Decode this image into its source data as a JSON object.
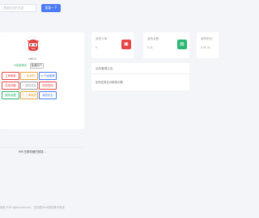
{
  "search": {
    "placeholder": "入需要查询的关键",
    "button_label": "我要一下"
  },
  "profile": {
    "avatar_icon": "smiling-face-icon",
    "username": "UID:2",
    "vip_label": "※仙发网中",
    "level_badge": "普通用户",
    "grid": [
      {
        "label": "立即刷新",
        "color": "#e64545"
      },
      {
        "label": "☆ 免费购",
        "color": "#e6a23c"
      },
      {
        "label": "★ 升级套餐",
        "color": "#4a7bf4"
      },
      {
        "label": "在线问题",
        "color": "#e64545"
      },
      {
        "label": "☆ 我的钱包",
        "color": "#999999"
      },
      {
        "label": "修改密码",
        "color": "#e64545"
      },
      {
        "label": "服务收藏",
        "color": "#2bb673"
      },
      {
        "label": "☆ 工单管理",
        "color": "#e6a23c"
      },
      {
        "label": "我的实名",
        "color": "#4a7bf4"
      }
    ],
    "footer_link": "Will 还原收藏的链接→"
  },
  "stats": [
    {
      "label": "我的订单",
      "value": "0",
      "icon": "cart-icon",
      "color": "#e64545"
    },
    {
      "label": "我的余额",
      "value": "0 元",
      "icon": "wallet-icon",
      "color": "#2bb673"
    },
    {
      "label": "我的积分",
      "value": "0.00 元",
      "icon": "",
      "color": ""
    }
  ],
  "notice": {
    "title": "站内管理公告",
    "items": [
      "如何还原自动框架问题"
    ]
  },
  "copyright": "版权 ft All rights reserved 。总站是Ant's团队集中系统"
}
